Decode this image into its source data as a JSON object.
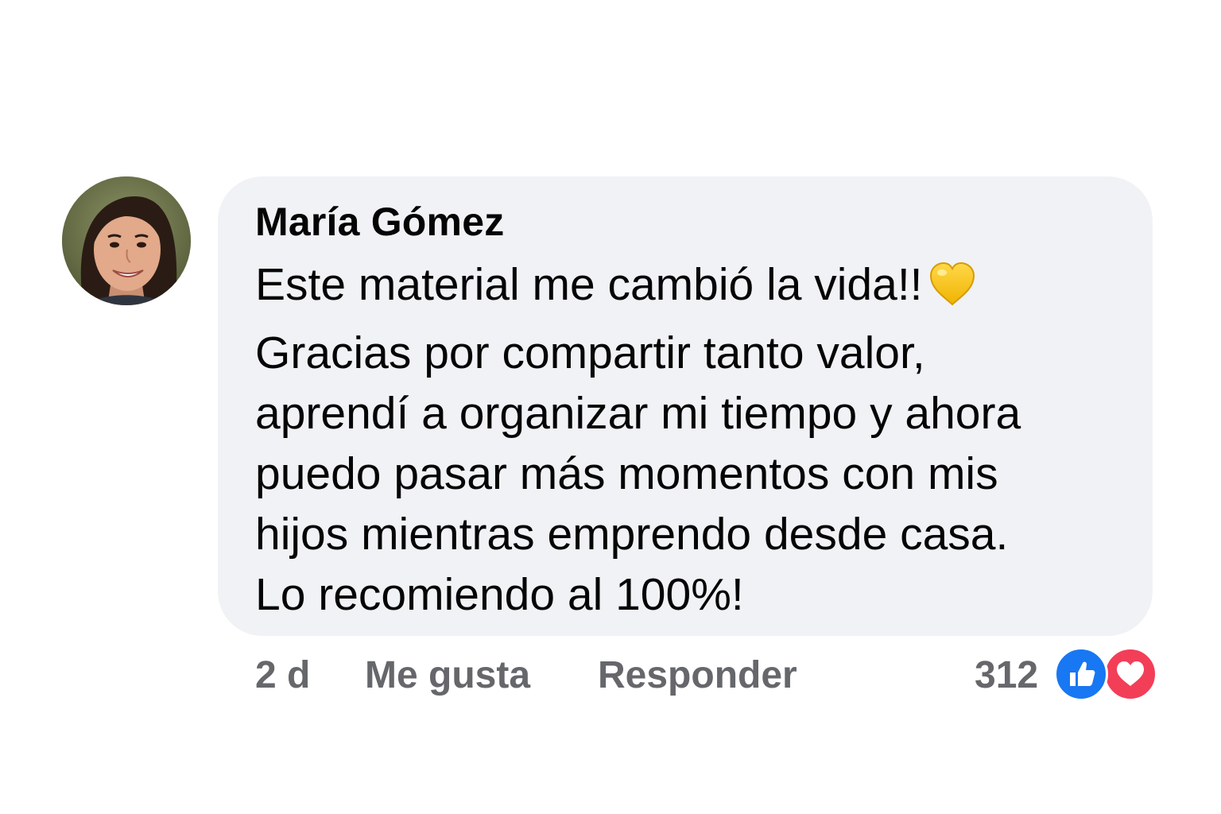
{
  "comment": {
    "author": "María Gómez",
    "lines": [
      "Este material me cambió la vida!!",
      "Gracias por compartir tanto valor,",
      "aprendí a organizar mi tiempo y ahora",
      "puedo pasar más momentos con mis",
      "hijos mientras emprendo desde casa.",
      "Lo recomiendo al 100%!"
    ],
    "emoji": "yellow-heart-icon"
  },
  "actions": {
    "time": "2 d",
    "like_label": "Me gusta",
    "reply_label": "Responder",
    "reaction_count": "312",
    "reactions": [
      "like-icon",
      "love-icon"
    ]
  },
  "colors": {
    "bubble": "#f0f2f5",
    "text": "#050505",
    "secondary": "#65676b",
    "like_blue": "#1877f2",
    "love_red": "#f33e58",
    "yellow_heart": "#f7c52b"
  }
}
